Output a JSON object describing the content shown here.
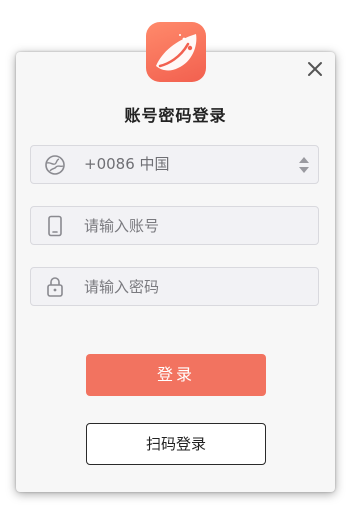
{
  "dialog": {
    "title": "账号密码登录",
    "close_icon": "close-icon"
  },
  "logo": {
    "icon": "app-logo-icon",
    "color": "#f2604f"
  },
  "fields": {
    "region": {
      "value": "+0086 中国",
      "icon": "globe-icon"
    },
    "account": {
      "placeholder": "请输入账号",
      "icon": "phone-icon"
    },
    "password": {
      "placeholder": "请输入密码",
      "icon": "lock-icon"
    }
  },
  "buttons": {
    "login_label": "登录",
    "qr_login_label": "扫码登录",
    "accent_color": "#f27360"
  }
}
